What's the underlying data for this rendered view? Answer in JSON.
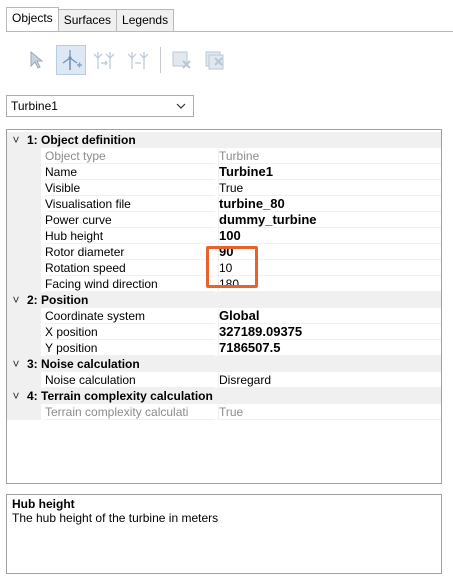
{
  "tabs": [
    {
      "label": "Objects",
      "active": true
    },
    {
      "label": "Surfaces",
      "active": false
    },
    {
      "label": "Legends",
      "active": false
    }
  ],
  "toolbar": {
    "buttons": [
      {
        "icon": "select-arrow-icon",
        "pressed": false
      },
      {
        "icon": "add-turbine-icon",
        "pressed": true
      },
      {
        "icon": "move-turbine-icon",
        "pressed": false
      },
      {
        "icon": "copy-turbine-icon",
        "pressed": false
      },
      {
        "icon": "delete-object-icon",
        "pressed": false
      },
      {
        "icon": "delete-all-icon",
        "pressed": false
      }
    ]
  },
  "object_select": {
    "value": "Turbine1"
  },
  "grid": {
    "categories": [
      {
        "label": "1: Object definition",
        "expander": "˅",
        "properties": [
          {
            "name": "Object type",
            "value": "Turbine",
            "readonly": true,
            "bold": false
          },
          {
            "name": "Name",
            "value": "Turbine1",
            "readonly": false,
            "bold": true
          },
          {
            "name": "Visible",
            "value": "True",
            "readonly": false,
            "bold": false
          },
          {
            "name": "Visualisation file",
            "value": "turbine_80",
            "readonly": false,
            "bold": true
          },
          {
            "name": "Power curve",
            "value": "dummy_turbine",
            "readonly": false,
            "bold": true
          },
          {
            "name": "Hub height",
            "value": "100",
            "readonly": false,
            "bold": true
          },
          {
            "name": "Rotor diameter",
            "value": "90",
            "readonly": false,
            "bold": true
          },
          {
            "name": "Rotation speed",
            "value": "10",
            "readonly": false,
            "bold": false
          },
          {
            "name": "Facing wind direction",
            "value": "180",
            "readonly": false,
            "bold": false
          }
        ]
      },
      {
        "label": "2: Position",
        "expander": "˅",
        "properties": [
          {
            "name": "Coordinate system",
            "value": "Global",
            "readonly": false,
            "bold": true
          },
          {
            "name": "X position",
            "value": "327189.09375",
            "readonly": false,
            "bold": true
          },
          {
            "name": "Y position",
            "value": "7186507.5",
            "readonly": false,
            "bold": true
          }
        ]
      },
      {
        "label": "3: Noise calculation",
        "expander": "˅",
        "properties": [
          {
            "name": "Noise calculation",
            "value": "Disregard",
            "readonly": false,
            "bold": false
          }
        ]
      },
      {
        "label": "4: Terrain complexity calculation",
        "expander": "˅",
        "properties": [
          {
            "name": "Terrain complexity calculati",
            "value": "True",
            "readonly": true,
            "bold": false
          }
        ]
      }
    ]
  },
  "help": {
    "title": "Hub height",
    "description": "The hub height of the turbine in meters"
  },
  "colors": {
    "highlight_border": "#e8622a",
    "category_bg": "#f0f0f0",
    "readonly_text": "#8c8c8c"
  }
}
